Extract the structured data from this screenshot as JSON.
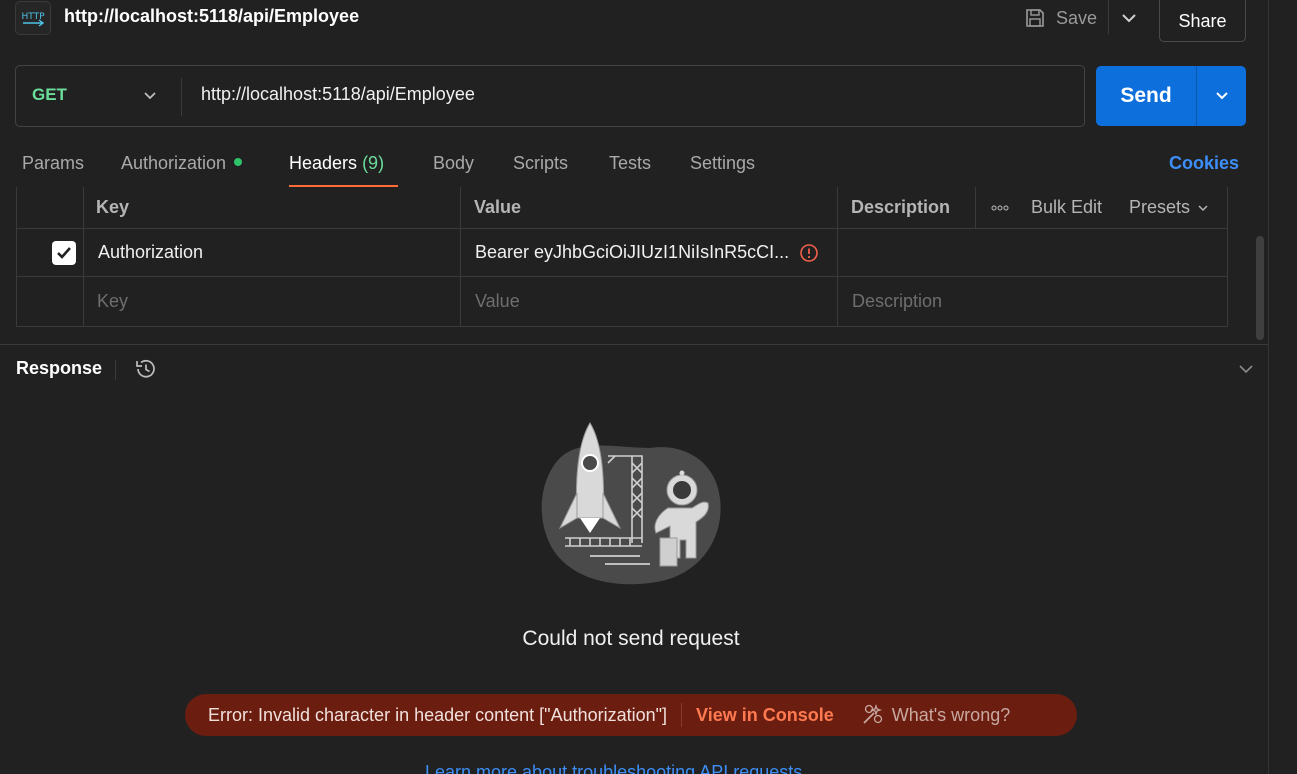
{
  "header": {
    "badge": "HTTP",
    "title": "http://localhost:5118/api/Employee",
    "save_label": "Save",
    "share_label": "Share"
  },
  "request": {
    "method": "GET",
    "url": "http://localhost:5118/api/Employee",
    "send_label": "Send"
  },
  "tabs": [
    {
      "label": "Params"
    },
    {
      "label": "Authorization"
    },
    {
      "label": "Headers",
      "count": "(9)"
    },
    {
      "label": "Body"
    },
    {
      "label": "Scripts"
    },
    {
      "label": "Tests"
    },
    {
      "label": "Settings"
    }
  ],
  "cookies_label": "Cookies",
  "headers_table": {
    "columns": {
      "key": "Key",
      "value": "Value",
      "description": "Description",
      "bulk_edit": "Bulk Edit",
      "presets": "Presets"
    },
    "rows": [
      {
        "checked": true,
        "key": "Authorization",
        "value": "Bearer eyJhbGciOiJIUzI1NiIsInR5cCI...",
        "description": ""
      }
    ],
    "placeholder": {
      "key": "Key",
      "value": "Value",
      "description": "Description"
    }
  },
  "response": {
    "title": "Response",
    "empty_message": "Could not send request",
    "error": {
      "text": "Error: Invalid character in header content [\"Authorization\"]",
      "view_console": "View in Console",
      "whats_wrong": "What's wrong?"
    },
    "learn_link": "Learn more about troubleshooting API requests"
  },
  "colors": {
    "accent_orange": "#ff6c37",
    "send_blue": "#0c6fdb",
    "method_green": "#6bdd9a",
    "error_bg": "#6b1e10"
  }
}
